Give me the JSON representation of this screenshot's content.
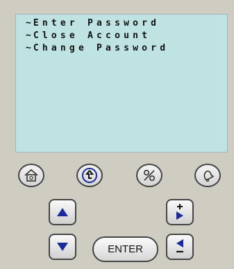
{
  "screen": {
    "menu_items": [
      {
        "marker": "~",
        "label": "Enter Password"
      },
      {
        "marker": "~",
        "label": "Close Account"
      },
      {
        "marker": "~",
        "label": "Change Password"
      }
    ]
  },
  "keypad": {
    "enter_label": "ENTER",
    "icons": [
      "home-icon",
      "up-level-icon",
      "percent-icon",
      "bell-icon",
      "arrow-up-icon",
      "plus-right-icon",
      "arrow-down-icon",
      "minus-left-icon"
    ]
  },
  "colors": {
    "panel": "#cfccc2",
    "screen": "#bfe3e3",
    "icon_blue": "#1a2a9a"
  }
}
